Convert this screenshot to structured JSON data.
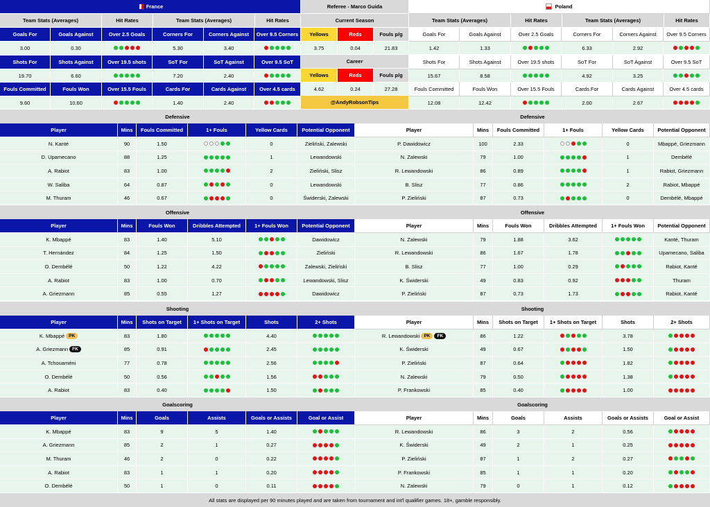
{
  "header": {
    "france": "France",
    "referee": "Referee - Marco Guida",
    "poland": "Poland"
  },
  "team_header": {
    "team_stats": "Team Stats (Averages)",
    "hit_rates": "Hit Rates"
  },
  "ref": {
    "current_season": "Current Season",
    "career": "Career",
    "yellows": "Yellows",
    "reds": "Reds",
    "fouls_pg": "Fouls p/g",
    "cur_vals": [
      "3.75",
      "0.04",
      "21.83"
    ],
    "car_vals": [
      "4.62",
      "0.24",
      "27.28"
    ],
    "tips": "@AndyRobsonTips"
  },
  "team_stats": {
    "france": {
      "rows": [
        {
          "h": [
            "Goals For",
            "Goals Against",
            "Over 2.5 Goals",
            "Corners For",
            "Corners Against",
            "Over 9.5 Corners"
          ],
          "v": [
            "3.00",
            "0.30",
            "ggrrr",
            "5.30",
            "3.40",
            "rgggg"
          ]
        },
        {
          "h": [
            "Shots For",
            "Shots Against",
            "Over 19.5 shots",
            "SoT For",
            "SoT Against",
            "Over 9.5 SoT"
          ],
          "v": [
            "19.70",
            "6.60",
            "ggggg",
            "7.20",
            "2.40",
            "rgggg"
          ]
        },
        {
          "h": [
            "Fouls Committed",
            "Fouls Won",
            "Over 15.5 Fouls",
            "Cards For",
            "Cards Against",
            "Over 4.5 cards"
          ],
          "v": [
            "9.60",
            "10.60",
            "rgggg",
            "1.40",
            "2.40",
            "rrggg"
          ]
        }
      ]
    },
    "poland": {
      "rows": [
        {
          "h": [
            "Goals For",
            "Goals Against",
            "Over 2.5 Goals",
            "Corners For",
            "Corners Against",
            "Over 9.5 Corners"
          ],
          "v": [
            "1.42",
            "1.33",
            "grggg",
            "6.33",
            "2.92",
            "rgrrg"
          ]
        },
        {
          "h": [
            "Shots For",
            "Shots Against",
            "Over 19.5 shots",
            "SoT For",
            "SoT Against",
            "Over 9.5 SoT"
          ],
          "v": [
            "15.67",
            "8.58",
            "ggggg",
            "4.92",
            "3.25",
            "ggrgg"
          ]
        },
        {
          "h": [
            "Fouls Committed",
            "Fouls Won",
            "Over 15.5 Fouls",
            "Cards For",
            "Cards Against",
            "Over 4.5 cards"
          ],
          "v": [
            "12.08",
            "12.42",
            "rgggg",
            "2.00",
            "2.67",
            "rrrrg"
          ]
        }
      ]
    }
  },
  "sections": [
    {
      "title": "Defensive",
      "left_cols": [
        "Player",
        "Mins",
        "Fouls Committed",
        "1+ Fouls",
        "Yellow Cards",
        "Potential Opponent"
      ],
      "right_cols": [
        "Player",
        "Mins",
        "Fouls Committed",
        "1+ Fouls",
        "Yellow Cards",
        "Potential Opponent"
      ],
      "left": [
        [
          "N. Kanté",
          "90",
          "1.50",
          "eeegg",
          "0",
          "Zieliński, Zalewski"
        ],
        [
          "D. Upamecano",
          "88",
          "1.25",
          "ggggg",
          "1",
          "Lewandowski"
        ],
        [
          "A. Rabiot",
          "83",
          "1.00",
          "ggggr",
          "2",
          "Zieliński, Slisz"
        ],
        [
          "W. Saliba",
          "64",
          "0.87",
          "grgrg",
          "0",
          "Lewandowski"
        ],
        [
          "M. Thuram",
          "46",
          "0.67",
          "grrrg",
          "0",
          "Świderski, Zalewski"
        ]
      ],
      "right": [
        [
          "P. Dawidowicz",
          "100",
          "2.33",
          "eergg",
          "0",
          "Mbappé, Griezmann"
        ],
        [
          "N. Zalewski",
          "79",
          "1.00",
          "ggggr",
          "1",
          "Dembélé"
        ],
        [
          "R. Lewandowski",
          "86",
          "0.89",
          "ggggr",
          "1",
          "Rabiot, Griezmann"
        ],
        [
          "B. Slisz",
          "77",
          "0.86",
          "ggggg",
          "2",
          "Rabiot, Mbappé"
        ],
        [
          "P. Zieliński",
          "87",
          "0.73",
          "grggg",
          "0",
          "Dembélé, Mbappé"
        ]
      ]
    },
    {
      "title": "Offensive",
      "left_cols": [
        "Player",
        "Mins",
        "Fouls Won",
        "Dribbles Attempted",
        "1+ Fouls Won",
        "Potential Opponent"
      ],
      "right_cols": [
        "Player",
        "Mins",
        "Fouls Won",
        "Dribbles Attempted",
        "1+ Fouls Won",
        "Potential Opponent"
      ],
      "left": [
        [
          "K. Mbappé",
          "83",
          "1.40",
          "5.10",
          "ggrgg",
          "Dawidowicz"
        ],
        [
          "T. Hernández",
          "84",
          "1.25",
          "1.50",
          "grrgg",
          "Zieliński"
        ],
        [
          "O. Dembélé",
          "50",
          "1.22",
          "4.22",
          "rgggg",
          "Zalewski, Zieliński"
        ],
        [
          "A. Rabiot",
          "83",
          "1.00",
          "0.70",
          "grrgg",
          "Lewandowski, Slisz"
        ],
        [
          "A. Griezmann",
          "85",
          "0.55",
          "1.27",
          "rrrrg",
          "Dawidowicz"
        ]
      ],
      "right": [
        [
          "N. Zalewski",
          "79",
          "1.88",
          "3.62",
          "ggggg",
          "Kanté, Thuram"
        ],
        [
          "R. Lewandowski",
          "86",
          "1.67",
          "1.78",
          "ggrgg",
          "Upamecano, Saliba"
        ],
        [
          "B. Slisz",
          "77",
          "1.00",
          "0.29",
          "grggg",
          "Rabiot, Kanté"
        ],
        [
          "K. Świderski",
          "49",
          "0.83",
          "0.92",
          "rrrgg",
          "Thuram"
        ],
        [
          "P. Zieliński",
          "87",
          "0.73",
          "1.73",
          "grrgg",
          "Rabiot, Kanté"
        ]
      ]
    },
    {
      "title": "Shooting",
      "left_cols": [
        "Player",
        "Mins",
        "Shots on Target",
        "1+ Shots on Target",
        "Shots",
        "2+ Shots"
      ],
      "right_cols": [
        "Player",
        "Mins",
        "Shots on Target",
        "1+ Shots on Target",
        "Shots",
        "2+ Shots"
      ],
      "left": [
        [
          "K. Mbappé",
          "83",
          "1.80",
          "ggggg",
          "4.40",
          "ggggg"
        ],
        [
          "A. Griezmann",
          "85",
          "0.91",
          "rgggg",
          "2.45",
          "ggggg"
        ],
        [
          "A. Tchouaméni",
          "77",
          "0.78",
          "ggggg",
          "2.56",
          "ggggr"
        ],
        [
          "O. Dembélé",
          "50",
          "0.56",
          "ggrgg",
          "1.56",
          "rrggg"
        ],
        [
          "A. Rabiot",
          "83",
          "0.40",
          "ggggr",
          "1.50",
          "grggg"
        ]
      ],
      "right": [
        [
          "R. Lewandowski",
          "86",
          "1.22",
          "rgrgg",
          "3.78",
          "grrrr"
        ],
        [
          "K. Świderski",
          "49",
          "0.67",
          "rgrrg",
          "1.50",
          "grrrr"
        ],
        [
          "P. Zieliński",
          "87",
          "0.64",
          "grrrr",
          "1.82",
          "grrrr"
        ],
        [
          "N. Zalewski",
          "79",
          "0.50",
          "grrrr",
          "1.38",
          "grrrr"
        ],
        [
          "P. Frankowski",
          "85",
          "0.40",
          "grrrr",
          "1.00",
          "rrrrr"
        ]
      ]
    },
    {
      "title": "Goalscoring",
      "left_cols": [
        "Player",
        "Mins",
        "Goals",
        "Assists",
        "Goals or Assists",
        "Goal or Assist"
      ],
      "right_cols": [
        "Player",
        "Mins",
        "Goals",
        "Assists",
        "Goals or Assists",
        "Goal or Assist"
      ],
      "left": [
        [
          "K. Mbappé",
          "83",
          "9",
          "5",
          "1.40",
          "grggg"
        ],
        [
          "A. Griezmann",
          "85",
          "2",
          "1",
          "0.27",
          "rrrrg"
        ],
        [
          "M. Thuram",
          "46",
          "2",
          "0",
          "0.22",
          "rrrrg"
        ],
        [
          "A. Rabiot",
          "83",
          "1",
          "1",
          "0.20",
          "rrrrg"
        ],
        [
          "O. Dembélé",
          "50",
          "1",
          "0",
          "0.11",
          "rrrrg"
        ]
      ],
      "right": [
        [
          "R. Lewandowski",
          "86",
          "3",
          "2",
          "0.56",
          "grrrr"
        ],
        [
          "K. Świderski",
          "49",
          "2",
          "1",
          "0.25",
          "rrrrr"
        ],
        [
          "P. Zieliński",
          "87",
          "1",
          "2",
          "0.27",
          "rggrg"
        ],
        [
          "P. Frankowski",
          "85",
          "1",
          "1",
          "0.20",
          "grggr"
        ],
        [
          "N. Zalewski",
          "79",
          "0",
          "1",
          "0.12",
          "grrrr"
        ]
      ]
    }
  ],
  "badges": {
    "pk": "PK",
    "fk": "FK"
  },
  "footer": "All stats are displayed per 90 minutes played and are taken from tournament and int'l qualifier games. 18+, gamble responsibly."
}
